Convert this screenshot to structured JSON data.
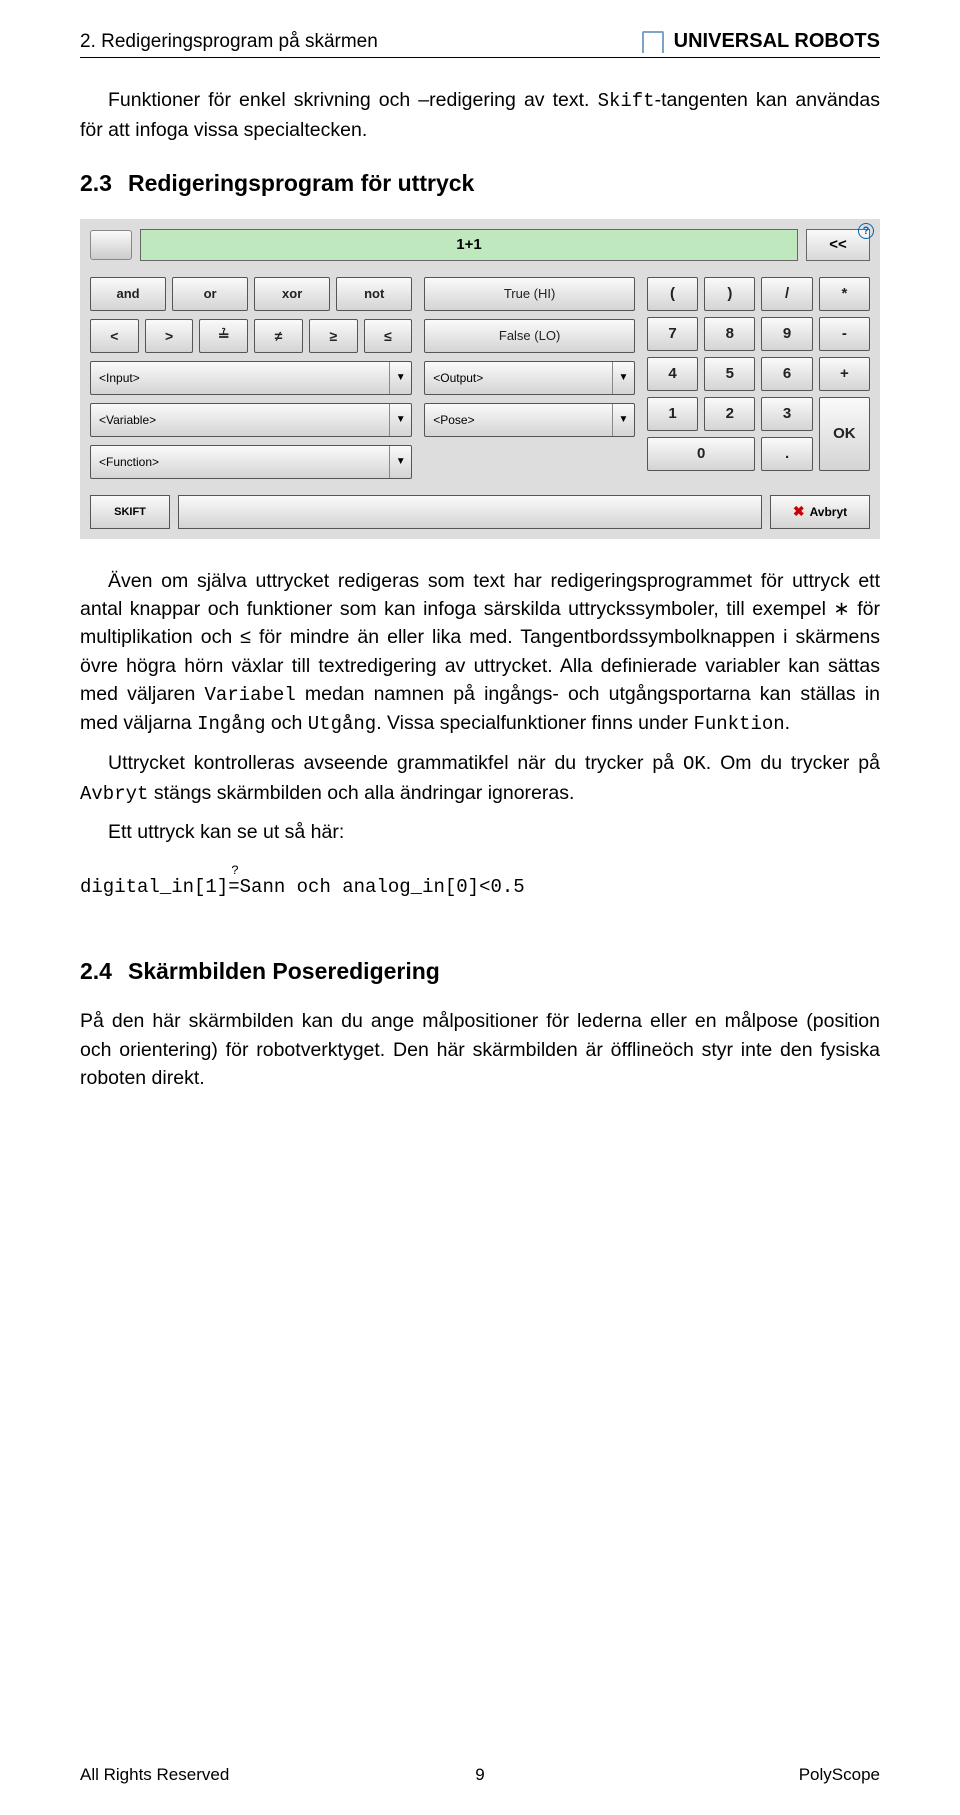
{
  "header": {
    "running_title": "2. Redigeringsprogram på skärmen",
    "brand": "UNIVERSAL ROBOTS"
  },
  "para_intro_1": "Funktioner för enkel skrivning och –redigering av text. ",
  "para_intro_code": "Skift",
  "para_intro_2": "-tangenten kan användas för att infoga vissa specialtecken.",
  "section_2_3": {
    "num": "2.3",
    "title": "Redigeringsprogram för uttryck"
  },
  "keyboard": {
    "expr_value": "1+1",
    "back": "<<",
    "ops_row1": [
      "and",
      "or",
      "xor",
      "not"
    ],
    "ops_row2": [
      "<",
      ">",
      "≟",
      "≠",
      "≥",
      "≤"
    ],
    "drop_input": "<Input>",
    "drop_output": "<Output>",
    "drop_variable": "<Variable>",
    "drop_pose": "<Pose>",
    "drop_function": "<Function>",
    "true_label": "True (HI)",
    "false_label": "False (LO)",
    "numpad": {
      "r1": [
        "(",
        ")",
        "/",
        "*"
      ],
      "r2": [
        "7",
        "8",
        "9",
        "-"
      ],
      "r3": [
        "4",
        "5",
        "6",
        "+"
      ],
      "r4": [
        "1",
        "2",
        "3"
      ],
      "ok": "OK",
      "zero": "0",
      "dot": "."
    },
    "skift": "SKIFT",
    "avbryt": "Avbryt"
  },
  "body_2_3_p1a": "Även om själva uttrycket redigeras som text har redigeringsprogrammet för uttryck ett antal knappar och funktioner som kan infoga särskilda uttryckssymboler, till exempel ∗ för multiplikation och ≤ för mindre än eller lika med. Tangentbordssymbolknappen i skärmens övre högra hörn växlar till textredigering av uttrycket. Alla definierade variabler kan sättas med väljaren ",
  "body_2_3_var": "Variabel",
  "body_2_3_p1b": " medan namnen på ingångs- och utgångsportarna kan ställas in med väljarna ",
  "body_2_3_in": "Ingång",
  "body_2_3_p1c": " och ",
  "body_2_3_out": "Utgång",
  "body_2_3_p1d": ". Vissa specialfunktioner finns under ",
  "body_2_3_fn": "Funktion",
  "body_2_3_p1e": ".",
  "body_2_3_p2a": "Uttrycket kontrolleras avseende grammatikfel när du trycker på ",
  "body_2_3_ok": "OK",
  "body_2_3_p2b": ". Om du trycker på ",
  "body_2_3_av": "Avbryt",
  "body_2_3_p2c": " stängs skärmbilden och alla ändringar ignoreras.",
  "body_2_3_p3": "Ett uttryck kan se ut så här:",
  "expr_example_a": "digital_in[1]",
  "expr_example_b": "Sann och analog_in[0]<0.5",
  "section_2_4": {
    "num": "2.4",
    "title": "Skärmbilden Poseredigering"
  },
  "body_2_4": "På den här skärmbilden kan du ange målpositioner för lederna eller en målpose (position och orientering) för robotverktyget. Den här skärmbilden är öfflineöch styr inte den fysiska roboten direkt.",
  "footer": {
    "left": "All Rights Reserved",
    "center": "9",
    "right": "PolyScope"
  }
}
